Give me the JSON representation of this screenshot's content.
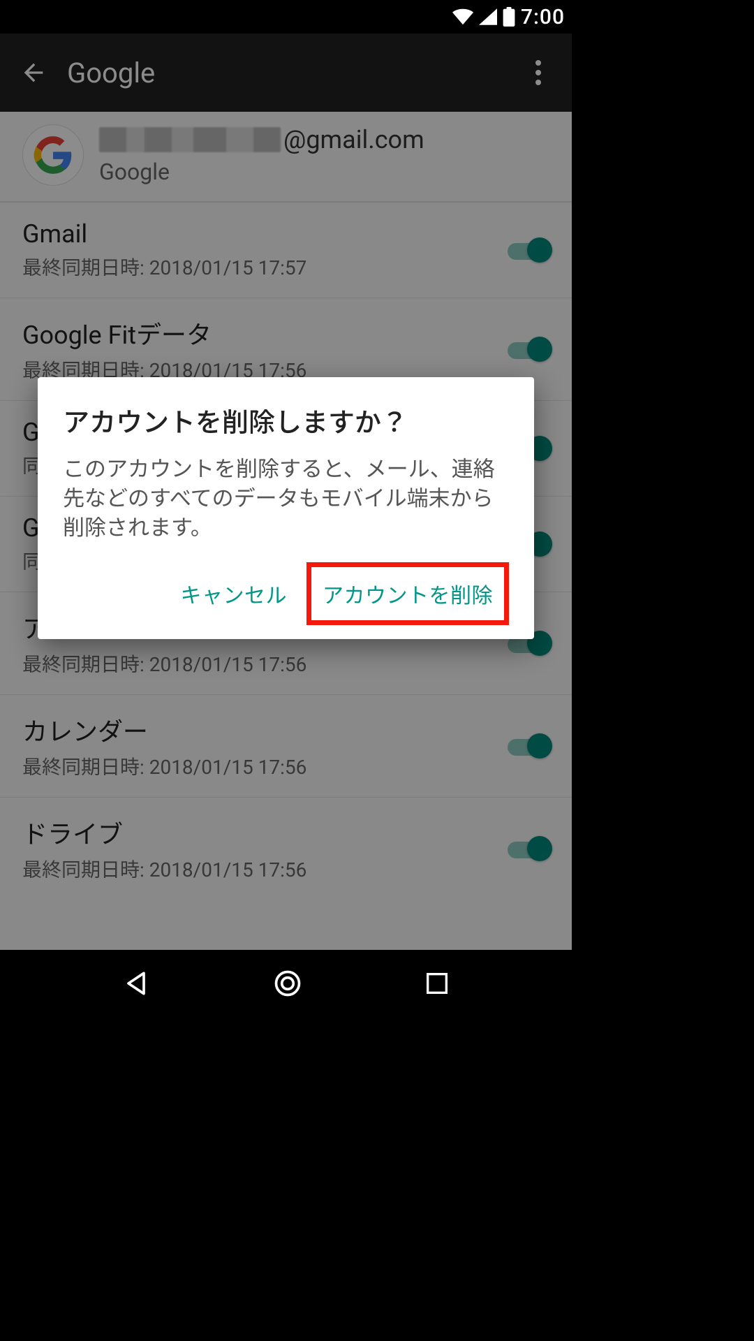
{
  "status": {
    "time": "7:00"
  },
  "appbar": {
    "title": "Google"
  },
  "account": {
    "email_suffix": "@gmail.com",
    "provider": "Google"
  },
  "sync_prefix": "最終同期日時: ",
  "sync_items": [
    {
      "title": "Gmail",
      "time": "2018/01/15 17:57",
      "on": true
    },
    {
      "title": "Google Fitデータ",
      "time": "2018/01/15 17:56",
      "on": true
    },
    {
      "title": "G",
      "time": "",
      "on": true
    },
    {
      "title": "G",
      "time": "",
      "on": true
    },
    {
      "title": "アプリデータ",
      "time": "2018/01/15 17:56",
      "on": true
    },
    {
      "title": "カレンダー",
      "time": "2018/01/15 17:56",
      "on": true
    },
    {
      "title": "ドライブ",
      "time": "2018/01/15 17:56",
      "on": true
    }
  ],
  "dialog": {
    "title": "アカウントを削除しますか？",
    "body": "このアカウントを削除すると、メール、連絡先などのすべてのデータもモバイル端末から削除されます。",
    "cancel": "キャンセル",
    "confirm": "アカウントを削除"
  }
}
